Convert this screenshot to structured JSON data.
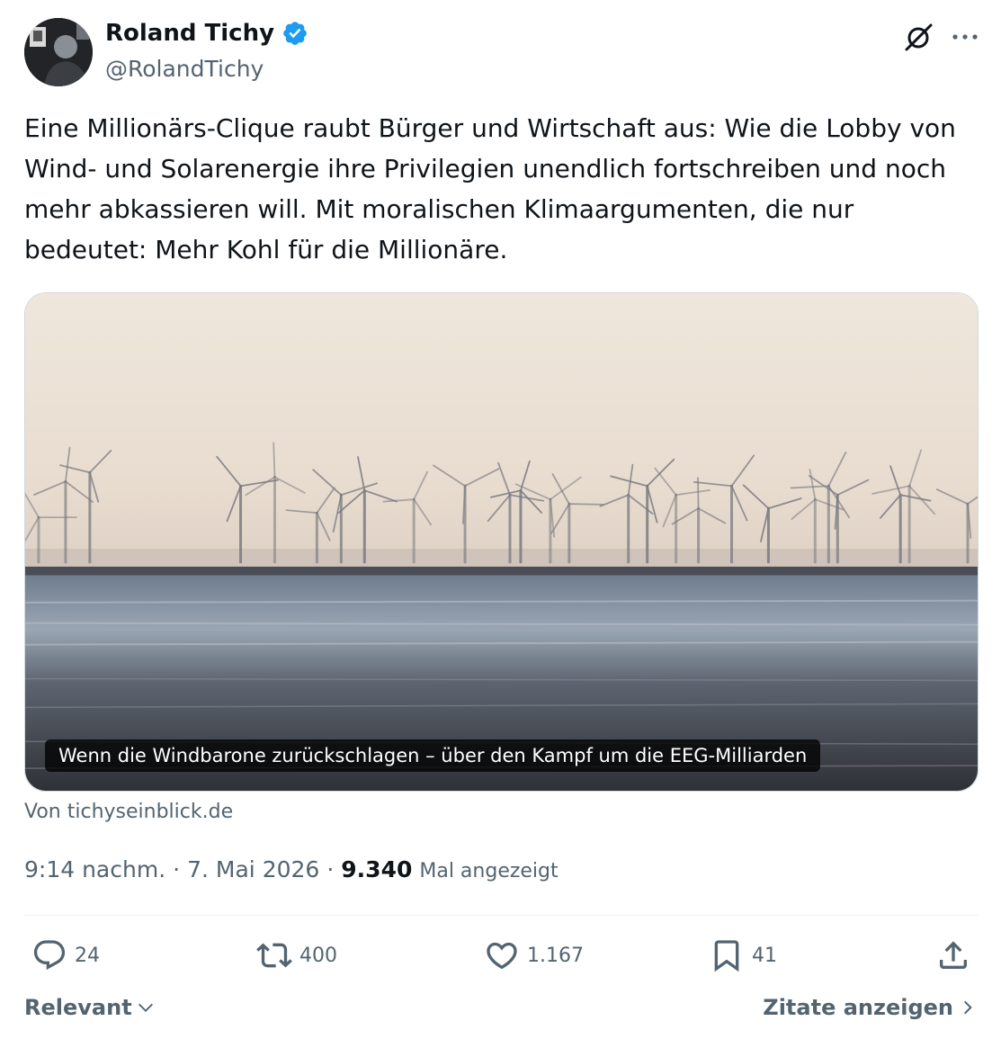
{
  "author": {
    "name": "Roland Tichy",
    "handle": "@RolandTichy",
    "verified": true
  },
  "tweet": {
    "text": "Eine Millionärs-Clique raubt Bürger und Wirtschaft aus: Wie die Lobby von Wind- und Solarenergie ihre Privilegien unendlich fortschreiben und noch mehr abkassieren will. Mit moralischen Klimaargumenten, die nur bedeutet: Mehr Kohl für die Millionäre."
  },
  "card": {
    "title": "Wenn die Windbarone zurückschlagen – über den Kampf um die EEG-Milliarden",
    "source": "Von tichyseinblick.de"
  },
  "meta": {
    "time": "9:14 nachm.",
    "separator": "·",
    "date": "7. Mai 2026",
    "views_count": "9.340",
    "views_label": "Mal angezeigt"
  },
  "actions": {
    "replies": "24",
    "reposts": "400",
    "likes": "1.167",
    "bookmarks": "41"
  },
  "footer": {
    "sort_label": "Relevant",
    "quotes_label": "Zitate anzeigen"
  },
  "icons": [
    "verified-badge-icon",
    "grok-icon",
    "more-icon",
    "reply-icon",
    "repost-icon",
    "like-icon",
    "bookmark-icon",
    "share-icon",
    "chevron-down-icon",
    "chevron-right-icon"
  ],
  "colors": {
    "verified": "#1d9bf0",
    "text": "#0f1419",
    "secondary": "#536471"
  }
}
